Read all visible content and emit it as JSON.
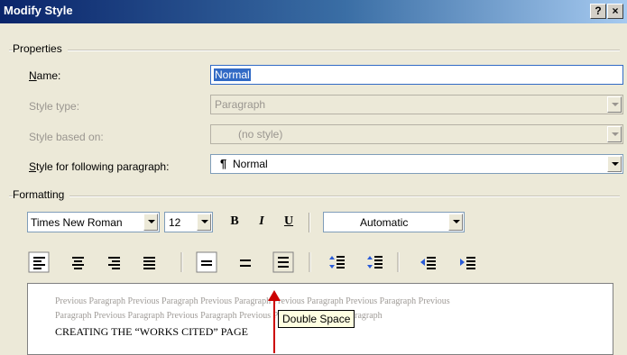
{
  "window": {
    "title": "Modify Style",
    "help_button": "?",
    "close_button": "×"
  },
  "properties": {
    "group_label": "Properties",
    "name_label": "Name:",
    "name_value": "Normal",
    "style_type_label": "Style type:",
    "style_type_value": "Paragraph",
    "style_based_on_label": "Style based on:",
    "style_based_on_value": "(no style)",
    "following_label": "Style for following paragraph:",
    "following_value": "Normal",
    "following_icon": "¶"
  },
  "formatting": {
    "group_label": "Formatting",
    "font_name": "Times New Roman",
    "font_size": "12",
    "bold_label": "B",
    "italic_label": "I",
    "underline_label": "U",
    "color_value": "Automatic"
  },
  "preview": {
    "previous_line1": "Previous Paragraph Previous Paragraph Previous Paragraph Previous Paragraph Previous Paragraph Previous",
    "previous_line2": "Paragraph Previous Paragraph Previous Paragraph Previous Paragraph Previous Paragraph",
    "main_text": "CREATING THE “WORKS CITED” PAGE"
  },
  "tooltip": {
    "text": "Double Space"
  },
  "colors": {
    "title_gradient_start": "#0a246a",
    "title_gradient_end": "#a6caf0",
    "arrow": "#cc0000",
    "tooltip_bg": "#ffffe1",
    "selection": "#316ac5"
  }
}
